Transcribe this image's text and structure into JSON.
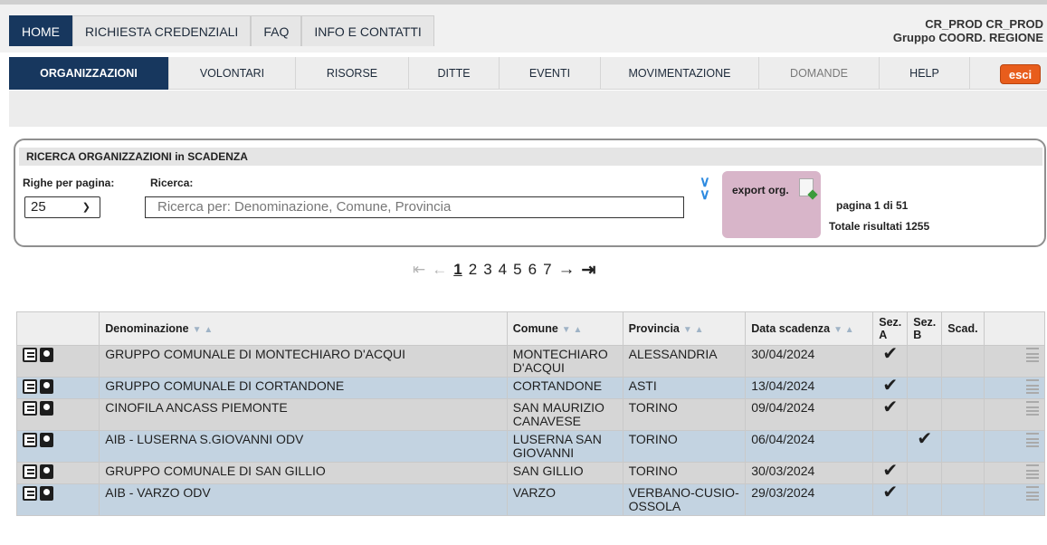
{
  "top_tabs": [
    {
      "label": "HOME"
    },
    {
      "label": "RICHIESTA CREDENZIALI"
    },
    {
      "label": "FAQ"
    },
    {
      "label": "INFO E CONTATTI"
    }
  ],
  "user": {
    "line1": "CR_PROD CR_PROD",
    "line2": "Gruppo COORD. REGIONE"
  },
  "nav": {
    "items": [
      {
        "label": "ORGANIZZAZIONI"
      },
      {
        "label": "VOLONTARI"
      },
      {
        "label": "RISORSE"
      },
      {
        "label": "DITTE"
      },
      {
        "label": "EVENTI"
      },
      {
        "label": "MOVIMENTAZIONE"
      },
      {
        "label": "DOMANDE"
      },
      {
        "label": "HELP"
      }
    ],
    "logout_label": "esci"
  },
  "search": {
    "title": "RICERCA ORGANIZZAZIONI in SCADENZA",
    "rows_label": "Righe per pagina:",
    "rows_value": "25",
    "search_label": "Ricerca:",
    "placeholder": "Ricerca per: Denominazione, Comune, Provincia",
    "export_label": "export org.",
    "page_info": "pagina 1 di 51",
    "total_info": "Totale risultati 1255"
  },
  "pager": {
    "first": "⇤",
    "prev": "←",
    "pages": [
      "1",
      "2",
      "3",
      "4",
      "5",
      "6",
      "7"
    ],
    "next": "→",
    "last": "⇥"
  },
  "table": {
    "headers": {
      "denominazione": "Denominazione",
      "comune": "Comune",
      "provincia": "Provincia",
      "data_scadenza": "Data scadenza",
      "sez_a": "Sez. A",
      "sez_b": "Sez. B",
      "scad": "Scad."
    },
    "rows": [
      {
        "denominazione": "GRUPPO COMUNALE DI MONTECHIARO D'ACQUI",
        "comune": "MONTECHIARO D'ACQUI",
        "provincia": "ALESSANDRIA",
        "data": "30/04/2024",
        "sez_a": "✔",
        "sez_b": ""
      },
      {
        "denominazione": "GRUPPO COMUNALE DI CORTANDONE",
        "comune": "CORTANDONE",
        "provincia": "ASTI",
        "data": "13/04/2024",
        "sez_a": "✔",
        "sez_b": ""
      },
      {
        "denominazione": "CINOFILA ANCASS PIEMONTE",
        "comune": "SAN MAURIZIO CANAVESE",
        "provincia": "TORINO",
        "data": "09/04/2024",
        "sez_a": "✔",
        "sez_b": ""
      },
      {
        "denominazione": "AIB - LUSERNA S.GIOVANNI ODV",
        "comune": "LUSERNA SAN GIOVANNI",
        "provincia": "TORINO",
        "data": "06/04/2024",
        "sez_a": "",
        "sez_b": "✔"
      },
      {
        "denominazione": "GRUPPO COMUNALE DI SAN GILLIO",
        "comune": "SAN GILLIO",
        "provincia": "TORINO",
        "data": "30/03/2024",
        "sez_a": "✔",
        "sez_b": ""
      },
      {
        "denominazione": "AIB - VARZO ODV",
        "comune": "VARZO",
        "provincia": "VERBANO-CUSIO-OSSOLA",
        "data": "29/03/2024",
        "sez_a": "✔",
        "sez_b": ""
      }
    ]
  },
  "colors": {
    "nav_active": "#17375e",
    "logout": "#e85d1c",
    "export_bg": "#d8b5c9",
    "row_grey": "#d6d6d6",
    "row_blue": "#c3d3e1"
  }
}
